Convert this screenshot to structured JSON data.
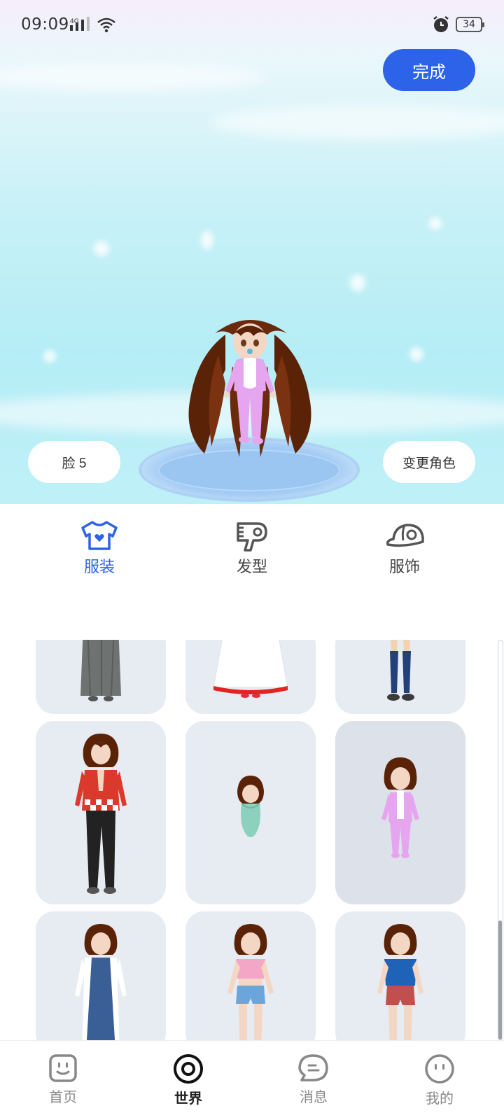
{
  "status_bar": {
    "time": "09:09",
    "network": "4G",
    "battery": "34"
  },
  "header": {
    "done_label": "完成"
  },
  "stage": {
    "face_label": "脸 5",
    "change_role_label": "变更角色"
  },
  "tabs": [
    {
      "label": "服装",
      "icon": "tshirt-icon",
      "active": true
    },
    {
      "label": "发型",
      "icon": "hair-dryer-icon",
      "active": false
    },
    {
      "label": "服饰",
      "icon": "cap-icon",
      "active": false
    }
  ],
  "outfits": [
    {
      "name": "grey-long-skirt-outfit"
    },
    {
      "name": "white-red-dress-outfit"
    },
    {
      "name": "navy-socks-outfit"
    },
    {
      "name": "red-checker-jacket-outfit"
    },
    {
      "name": "baby-swaddle-outfit"
    },
    {
      "name": "pink-baby-suit-outfit",
      "selected": true
    },
    {
      "name": "blue-dress-cardigan-outfit"
    },
    {
      "name": "pink-top-denim-shorts-outfit"
    },
    {
      "name": "blue-top-red-shorts-outfit"
    }
  ],
  "bottom_nav": [
    {
      "label": "首页",
      "icon": "home-face-icon",
      "active": false
    },
    {
      "label": "世界",
      "icon": "world-target-icon",
      "active": true
    },
    {
      "label": "消息",
      "icon": "message-bubble-icon",
      "active": false
    },
    {
      "label": "我的",
      "icon": "profile-smile-icon",
      "active": false
    }
  ],
  "colors": {
    "accent": "#2c63e8",
    "card_bg": "#e7ebf2",
    "sky": "#b5edf6"
  }
}
